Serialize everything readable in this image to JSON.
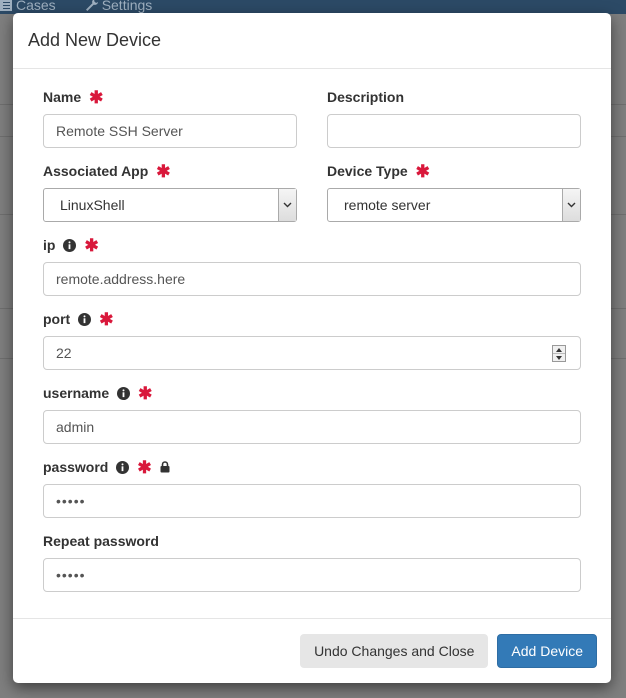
{
  "background": {
    "nav_items": [
      {
        "label": "Cases",
        "icon": "list-icon"
      },
      {
        "label": "Settings",
        "icon": "wrench-icon"
      }
    ]
  },
  "modal": {
    "title": "Add New Device",
    "fields": {
      "name": {
        "label": "Name",
        "value": "Remote SSH Server",
        "required": true
      },
      "description": {
        "label": "Description",
        "value": "",
        "required": false
      },
      "associated_app": {
        "label": "Associated App",
        "value": "LinuxShell",
        "required": true
      },
      "device_type": {
        "label": "Device Type",
        "value": "remote server",
        "required": true
      },
      "ip": {
        "label": "ip",
        "value": "remote.address.here",
        "required": true
      },
      "port": {
        "label": "port",
        "value": "22",
        "required": true
      },
      "username": {
        "label": "username",
        "value": "admin",
        "required": true
      },
      "password": {
        "label": "password",
        "value": "•••••",
        "required": true
      },
      "repeat_password": {
        "label": "Repeat password",
        "value": "•••••",
        "required": false
      }
    },
    "required_marker": "✱",
    "buttons": {
      "cancel": "Undo Changes and Close",
      "submit": "Add Device"
    }
  },
  "colors": {
    "required": "#d9183b",
    "primary": "#337ab7",
    "overlay": "#808080"
  }
}
